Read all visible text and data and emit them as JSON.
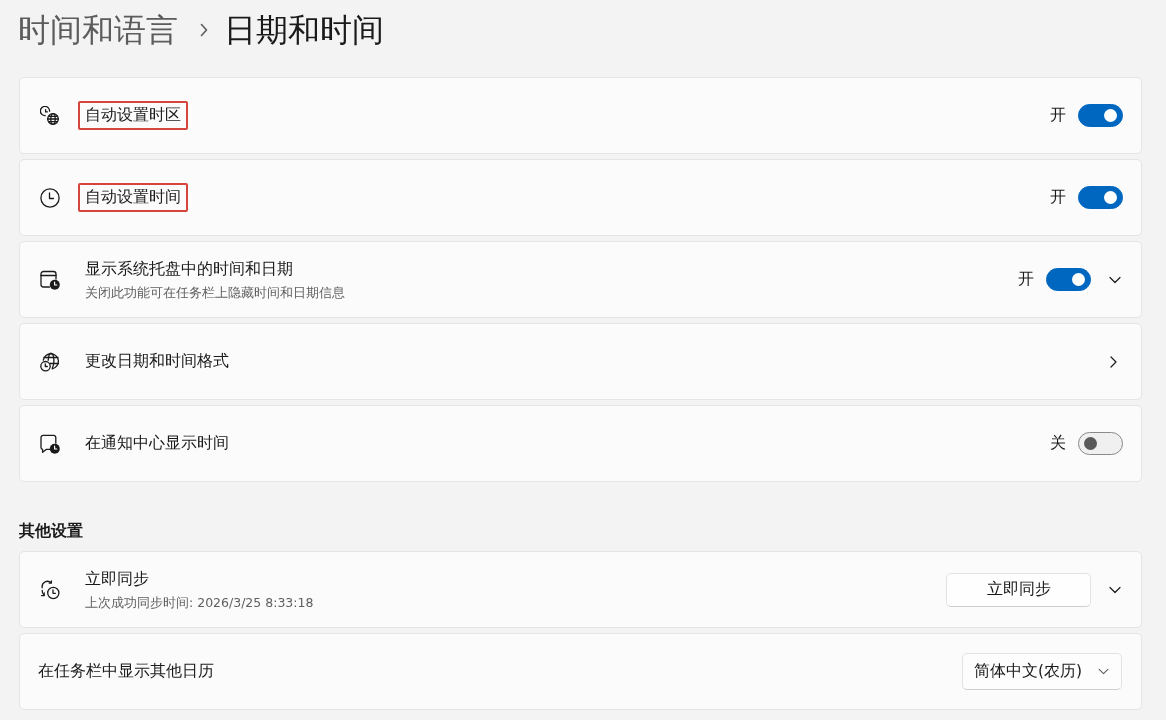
{
  "breadcrumb": [
    {
      "label": "时间和语言",
      "current": false
    },
    {
      "label": "日期和时间",
      "current": true
    }
  ],
  "sections": [
    {
      "rows": [
        {
          "kind": "toggle",
          "title": "自动设置时区",
          "highlighted": true,
          "state_label": "开",
          "on": true
        },
        {
          "kind": "toggle",
          "title": "自动设置时间",
          "highlighted": true,
          "state_label": "开",
          "on": true
        },
        {
          "kind": "toggle",
          "title": "显示系统托盘中的时间和日期",
          "subtitle": "关闭此功能可在任务栏上隐藏时间和日期信息",
          "highlighted": false,
          "state_label": "开",
          "on": true,
          "expanded": false
        },
        {
          "kind": "link",
          "title": "更改日期和时间格式",
          "highlighted": false
        },
        {
          "kind": "toggle",
          "title": "在通知中心显示时间",
          "highlighted": false,
          "state_label": "关",
          "on": false
        }
      ]
    },
    {
      "heading": "其他设置",
      "rows": [
        {
          "kind": "button",
          "title": "立即同步",
          "subtitle": "上次成功同步时间: 2026/3/25 8:33:18",
          "highlighted": false,
          "button": "立即同步",
          "expanded": false
        },
        {
          "kind": "dropdown",
          "title": "在任务栏中显示其他日历",
          "highlighted": false,
          "value": "简体中文(农历)"
        }
      ]
    }
  ]
}
